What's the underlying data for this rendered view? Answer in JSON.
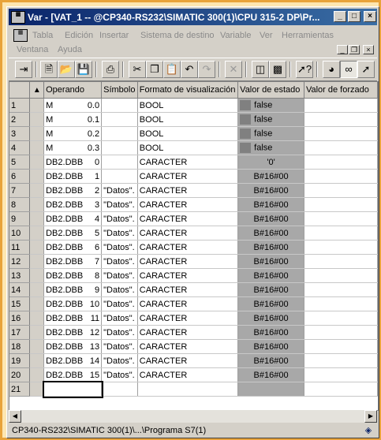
{
  "window": {
    "title": "Var - [VAT_1 -- @CP340-RS232\\SIMATIC 300(1)\\CPU 315-2 DP\\Pr...",
    "minimize_icon": "minimize-icon",
    "maximize_icon": "maximize-icon",
    "close_icon": "close-icon"
  },
  "menu": {
    "items": [
      "Tabla",
      "Edición",
      "Insertar",
      "Sistema de destino",
      "Variable",
      "Ver",
      "Herramientas",
      "Ventana",
      "Ayuda"
    ]
  },
  "toolbar": {
    "buttons": [
      "insert-row-icon",
      "new-icon",
      "open-icon",
      "save-icon",
      "print-icon",
      "cut-icon",
      "copy-icon",
      "paste-icon",
      "undo-icon",
      "redo-icon",
      "delete-icon",
      "online-icon",
      "modules-icon",
      "help-icon",
      "monitor-icon",
      "monitor-variable-icon",
      "modify-variable-icon"
    ]
  },
  "table": {
    "headers": [
      "Operando",
      "Símbolo",
      "Formato de visualización",
      "Valor de estado",
      "Valor de forzado"
    ],
    "rows": [
      {
        "n": "1",
        "op": "M",
        "addr": "0.0",
        "sym": "",
        "fmt": "BOOL",
        "val": "false",
        "swatch": true
      },
      {
        "n": "2",
        "op": "M",
        "addr": "0.1",
        "sym": "",
        "fmt": "BOOL",
        "val": "false",
        "swatch": true
      },
      {
        "n": "3",
        "op": "M",
        "addr": "0.2",
        "sym": "",
        "fmt": "BOOL",
        "val": "false",
        "swatch": true
      },
      {
        "n": "4",
        "op": "M",
        "addr": "0.3",
        "sym": "",
        "fmt": "BOOL",
        "val": "false",
        "swatch": true
      },
      {
        "n": "5",
        "op": "DB2.DBB",
        "addr": "0",
        "sym": "",
        "fmt": "CARACTER",
        "val": "'0'",
        "swatch": false
      },
      {
        "n": "6",
        "op": "DB2.DBB",
        "addr": "1",
        "sym": "",
        "fmt": "CARACTER",
        "val": "B#16#00",
        "swatch": false
      },
      {
        "n": "7",
        "op": "DB2.DBB",
        "addr": "2",
        "sym": "\"Datos\".",
        "fmt": "CARACTER",
        "val": "B#16#00",
        "swatch": false
      },
      {
        "n": "8",
        "op": "DB2.DBB",
        "addr": "3",
        "sym": "\"Datos\".",
        "fmt": "CARACTER",
        "val": "B#16#00",
        "swatch": false
      },
      {
        "n": "9",
        "op": "DB2.DBB",
        "addr": "4",
        "sym": "\"Datos\".",
        "fmt": "CARACTER",
        "val": "B#16#00",
        "swatch": false
      },
      {
        "n": "10",
        "op": "DB2.DBB",
        "addr": "5",
        "sym": "\"Datos\".",
        "fmt": "CARACTER",
        "val": "B#16#00",
        "swatch": false
      },
      {
        "n": "11",
        "op": "DB2.DBB",
        "addr": "6",
        "sym": "\"Datos\".",
        "fmt": "CARACTER",
        "val": "B#16#00",
        "swatch": false
      },
      {
        "n": "12",
        "op": "DB2.DBB",
        "addr": "7",
        "sym": "\"Datos\".",
        "fmt": "CARACTER",
        "val": "B#16#00",
        "swatch": false
      },
      {
        "n": "13",
        "op": "DB2.DBB",
        "addr": "8",
        "sym": "\"Datos\".",
        "fmt": "CARACTER",
        "val": "B#16#00",
        "swatch": false
      },
      {
        "n": "14",
        "op": "DB2.DBB",
        "addr": "9",
        "sym": "\"Datos\".",
        "fmt": "CARACTER",
        "val": "B#16#00",
        "swatch": false
      },
      {
        "n": "15",
        "op": "DB2.DBB",
        "addr": "10",
        "sym": "\"Datos\".",
        "fmt": "CARACTER",
        "val": "B#16#00",
        "swatch": false
      },
      {
        "n": "16",
        "op": "DB2.DBB",
        "addr": "11",
        "sym": "\"Datos\".",
        "fmt": "CARACTER",
        "val": "B#16#00",
        "swatch": false
      },
      {
        "n": "17",
        "op": "DB2.DBB",
        "addr": "12",
        "sym": "\"Datos\".",
        "fmt": "CARACTER",
        "val": "B#16#00",
        "swatch": false
      },
      {
        "n": "18",
        "op": "DB2.DBB",
        "addr": "13",
        "sym": "\"Datos\".",
        "fmt": "CARACTER",
        "val": "B#16#00",
        "swatch": false
      },
      {
        "n": "19",
        "op": "DB2.DBB",
        "addr": "14",
        "sym": "\"Datos\".",
        "fmt": "CARACTER",
        "val": "B#16#00",
        "swatch": false
      },
      {
        "n": "20",
        "op": "DB2.DBB",
        "addr": "15",
        "sym": "\"Datos\".",
        "fmt": "CARACTER",
        "val": "B#16#00",
        "swatch": false
      },
      {
        "n": "21",
        "op": "",
        "addr": "",
        "sym": "",
        "fmt": "",
        "val": "",
        "swatch": false
      }
    ]
  },
  "status": {
    "text": "CP340-RS232\\SIMATIC 300(1)\\...\\Programa S7(1)",
    "icon": "status-icon"
  }
}
